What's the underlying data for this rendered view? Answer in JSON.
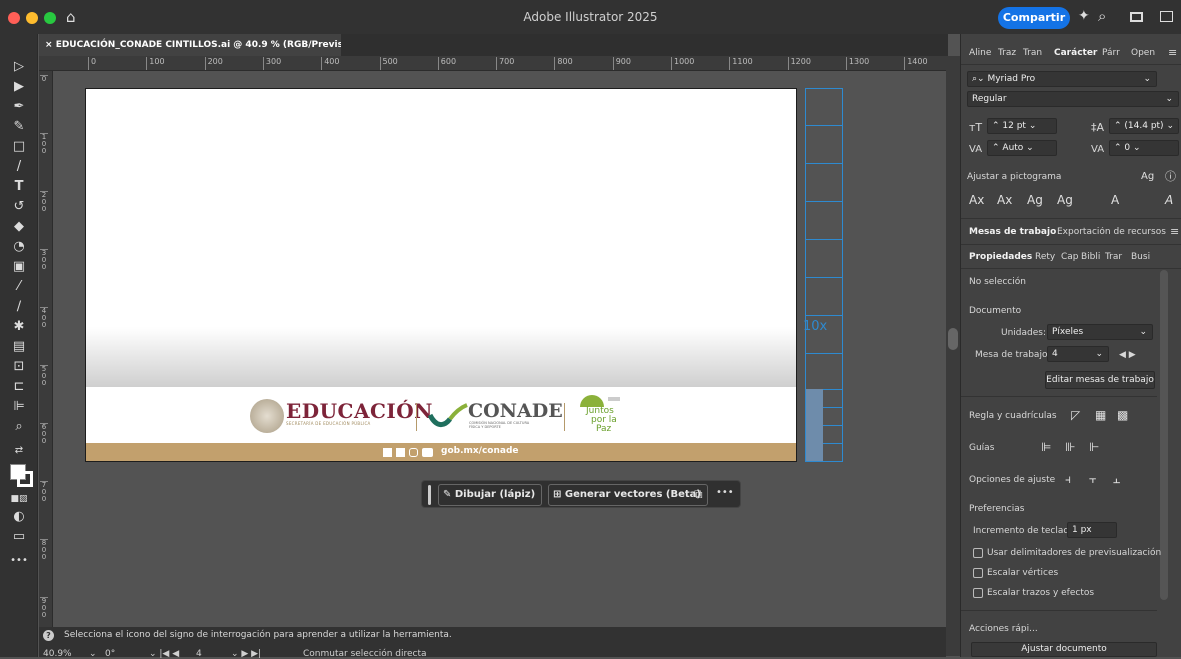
{
  "app": {
    "title": "Adobe Illustrator 2025",
    "share": "Compartir"
  },
  "document": {
    "tab": "EDUCACIÓN_CONADE CINTILLOS.ai @ 40.9 % (RGB/Previsualizar)",
    "tab_close": "×"
  },
  "ruler": {
    "h": [
      "0",
      "100",
      "200",
      "300",
      "400",
      "500",
      "600",
      "700",
      "800",
      "900",
      "1000",
      "1100",
      "1200",
      "1300",
      "1400"
    ],
    "v": [
      "0",
      "1\n0\n0",
      "2\n0\n0",
      "3\n0\n0",
      "4\n0\n0",
      "5\n0\n0",
      "6\n0\n0",
      "7\n0\n0",
      "8\n0\n0",
      "9\n0\n0"
    ]
  },
  "artwork": {
    "educacion": "EDUCACIÓN",
    "secretaria": "SECRETARÍA DE EDUCACIÓN PÚBLICA",
    "conade": "CONADE",
    "conade_sub": "COMISIÓN NACIONAL DE CULTURA FÍSICA Y DEPORTE",
    "juntos": [
      "Juntos",
      "por la",
      "Paz"
    ],
    "site": "gob.mx/conade",
    "grid_label": "10x"
  },
  "contextbar": {
    "draw": "Dibujar (lápiz)",
    "vectors": "Generar vectores (Beta)",
    "more": "•••"
  },
  "status": {
    "hint": "Selecciona el icono del signo de interrogación para aprender a utilizar la herramienta.",
    "zoom": "40.9%",
    "rotation": "0°",
    "artboard": "4",
    "mode": "Conmutar selección directa"
  },
  "panel": {
    "tabs1": [
      "Aline",
      "Traz",
      "Tran",
      "Carácter",
      "Párr",
      "Open"
    ],
    "font": "Myriad Pro",
    "style": "Regular",
    "size": "12 pt",
    "leading": "(14.4 pt)",
    "kerning": "Auto",
    "tracking": "0",
    "snap_glyph": "Ajustar a pictograma",
    "tabs2": [
      "Mesas de trabajo",
      "Exportación de recursos"
    ],
    "tabs3": [
      "Propiedades",
      "Rety",
      "Cap",
      "Bibli",
      "Trar",
      "Busi"
    ],
    "no_selection": "No selección",
    "documento": "Documento",
    "units_label": "Unidades:",
    "units": "Píxeles",
    "artboard_label": "Mesa de trabajo:",
    "artboard": "4",
    "edit_artboards": "Editar mesas de trabajo",
    "rulers": "Regla y cuadrículas",
    "guides": "Guías",
    "snap": "Opciones de ajuste",
    "prefs": "Preferencias",
    "increment_label": "Incremento de teclado:",
    "increment": "1 px",
    "cb1": "Usar delimitadores de previsualización",
    "cb2": "Escalar vértices",
    "cb3": "Escalar trazos y efectos",
    "quick": "Acciones rápi...",
    "fit": "Ajustar documento"
  }
}
